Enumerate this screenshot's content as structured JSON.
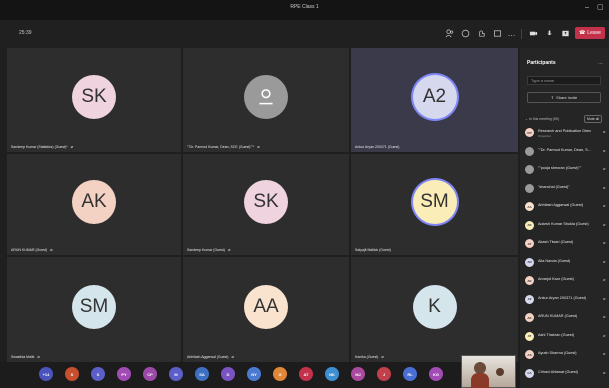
{
  "window": {
    "title": "RPE Class 1",
    "minimize": "–",
    "maximize": "▢"
  },
  "toolbar": {
    "timer": "25:39",
    "leave_label": "Leave",
    "icons": [
      "participants-icon",
      "chat-icon",
      "reactions-icon",
      "rooms-icon",
      "more-icon",
      "camera-icon",
      "mic-icon",
      "share-icon",
      "phone-icon"
    ]
  },
  "tiles": [
    {
      "initials": "SK",
      "name": "Sandeep Kumar (Statistics) (Guest)*",
      "color": "#efd3df",
      "muted": true
    },
    {
      "initials": "",
      "name": "\"\"Dr. Parmod Kumar, Dean, SCE (Guest)\"\"*",
      "color": "#9a9a9a",
      "muted": true
    },
    {
      "initials": "A2",
      "name": "Ankur Aryan 200371 (Guest)",
      "color": "#d6d8ee",
      "muted": false
    },
    {
      "initials": "AK",
      "name": "ARUN KUMAR (Guest)",
      "color": "#f3d2c3",
      "muted": true
    },
    {
      "initials": "SK",
      "name": "Sandeep Kumar (Guest)",
      "color": "#efd3df",
      "muted": true
    },
    {
      "initials": "SM",
      "name": "Satyajit Mallick (Guest)",
      "color": "#fbedb7",
      "muted": false
    },
    {
      "initials": "SM",
      "name": "Swasthia Malik",
      "color": "#d5e5ec",
      "muted": true
    },
    {
      "initials": "AA",
      "name": "Abhilash Aggarwal (Guest)",
      "color": "#f9e3cf",
      "muted": true
    },
    {
      "initials": "K",
      "name": "Kanika (Guest)",
      "color": "#d5e5ec",
      "muted": true
    }
  ],
  "strip": {
    "chips": [
      {
        "label": "+14",
        "color": "#4b53bc"
      },
      {
        "label": "S",
        "color": "#c64f2e"
      },
      {
        "label": "S",
        "color": "#5b5fc7"
      },
      {
        "label": "PY",
        "color": "#a24bb4"
      },
      {
        "label": "CP",
        "color": "#9b4aa8"
      },
      {
        "label": "M",
        "color": "#5b5fc7"
      },
      {
        "label": "SA",
        "color": "#3f6fc1"
      },
      {
        "label": "D",
        "color": "#7a53c2"
      },
      {
        "label": "NY",
        "color": "#4b7bd1"
      },
      {
        "label": "G",
        "color": "#e0873a"
      },
      {
        "label": "AT",
        "color": "#c3314b"
      },
      {
        "label": "NK",
        "color": "#3d8fd1"
      },
      {
        "label": "MJ",
        "color": "#a94a9e"
      },
      {
        "label": "J",
        "color": "#c2404b"
      },
      {
        "label": "RL",
        "color": "#4a6fd4"
      },
      {
        "label": "KG",
        "color": "#a24bb4"
      }
    ]
  },
  "participants": {
    "title": "Participants",
    "search_placeholder": "Type a name",
    "share_invite": "Share invite",
    "in_meeting": "In this meeting (59)",
    "mute_all": "Mute all",
    "list": [
      {
        "name": "Research and Publication Direc",
        "role": "Organizer",
        "color": "#f3d2c3",
        "initials": "RP"
      },
      {
        "name": "\"\"Dr. Parmod Kumar, Dean, S...",
        "role": "",
        "color": "#9a9a9a",
        "initials": ""
      },
      {
        "name": "\"\"pooja sheoran (Guest)\"\"",
        "role": "",
        "color": "#9a9a9a",
        "initials": ""
      },
      {
        "name": "\"shanchal (Guest)\"",
        "role": "",
        "color": "#9a9a9a",
        "initials": ""
      },
      {
        "name": "Abhilash Aggarwal (Guest)",
        "role": "",
        "color": "#f9e3cf",
        "initials": "AA"
      },
      {
        "name": "Adarsh Kumar Shukla (Guest)",
        "role": "",
        "color": "#fbedb7",
        "initials": "AK"
      },
      {
        "name": "Akash Tiwari (Guest)",
        "role": "",
        "color": "#f3d2c3",
        "initials": "AT"
      },
      {
        "name": "Alia Nanda (Guest)",
        "role": "",
        "color": "#d6d8ee",
        "initials": "AN"
      },
      {
        "name": "Amarjot Kaur (Guest)",
        "role": "",
        "color": "#f3d2c3",
        "initials": "AK"
      },
      {
        "name": "Ankur Aryan 200371 (Guest)",
        "role": "",
        "color": "#d6d8ee",
        "initials": "A2"
      },
      {
        "name": "ARUN KUMAR (Guest)",
        "role": "",
        "color": "#f3d2c3",
        "initials": "AK"
      },
      {
        "name": "Ashi Thakran (Guest)",
        "role": "",
        "color": "#fbedb7",
        "initials": "AT"
      },
      {
        "name": "Ayush Sharma (Guest)",
        "role": "",
        "color": "#f3d2c3",
        "initials": "AS"
      },
      {
        "name": "Chhavi Ahlawat (Guest)",
        "role": "",
        "color": "#d6d8ee",
        "initials": "CA"
      }
    ]
  }
}
